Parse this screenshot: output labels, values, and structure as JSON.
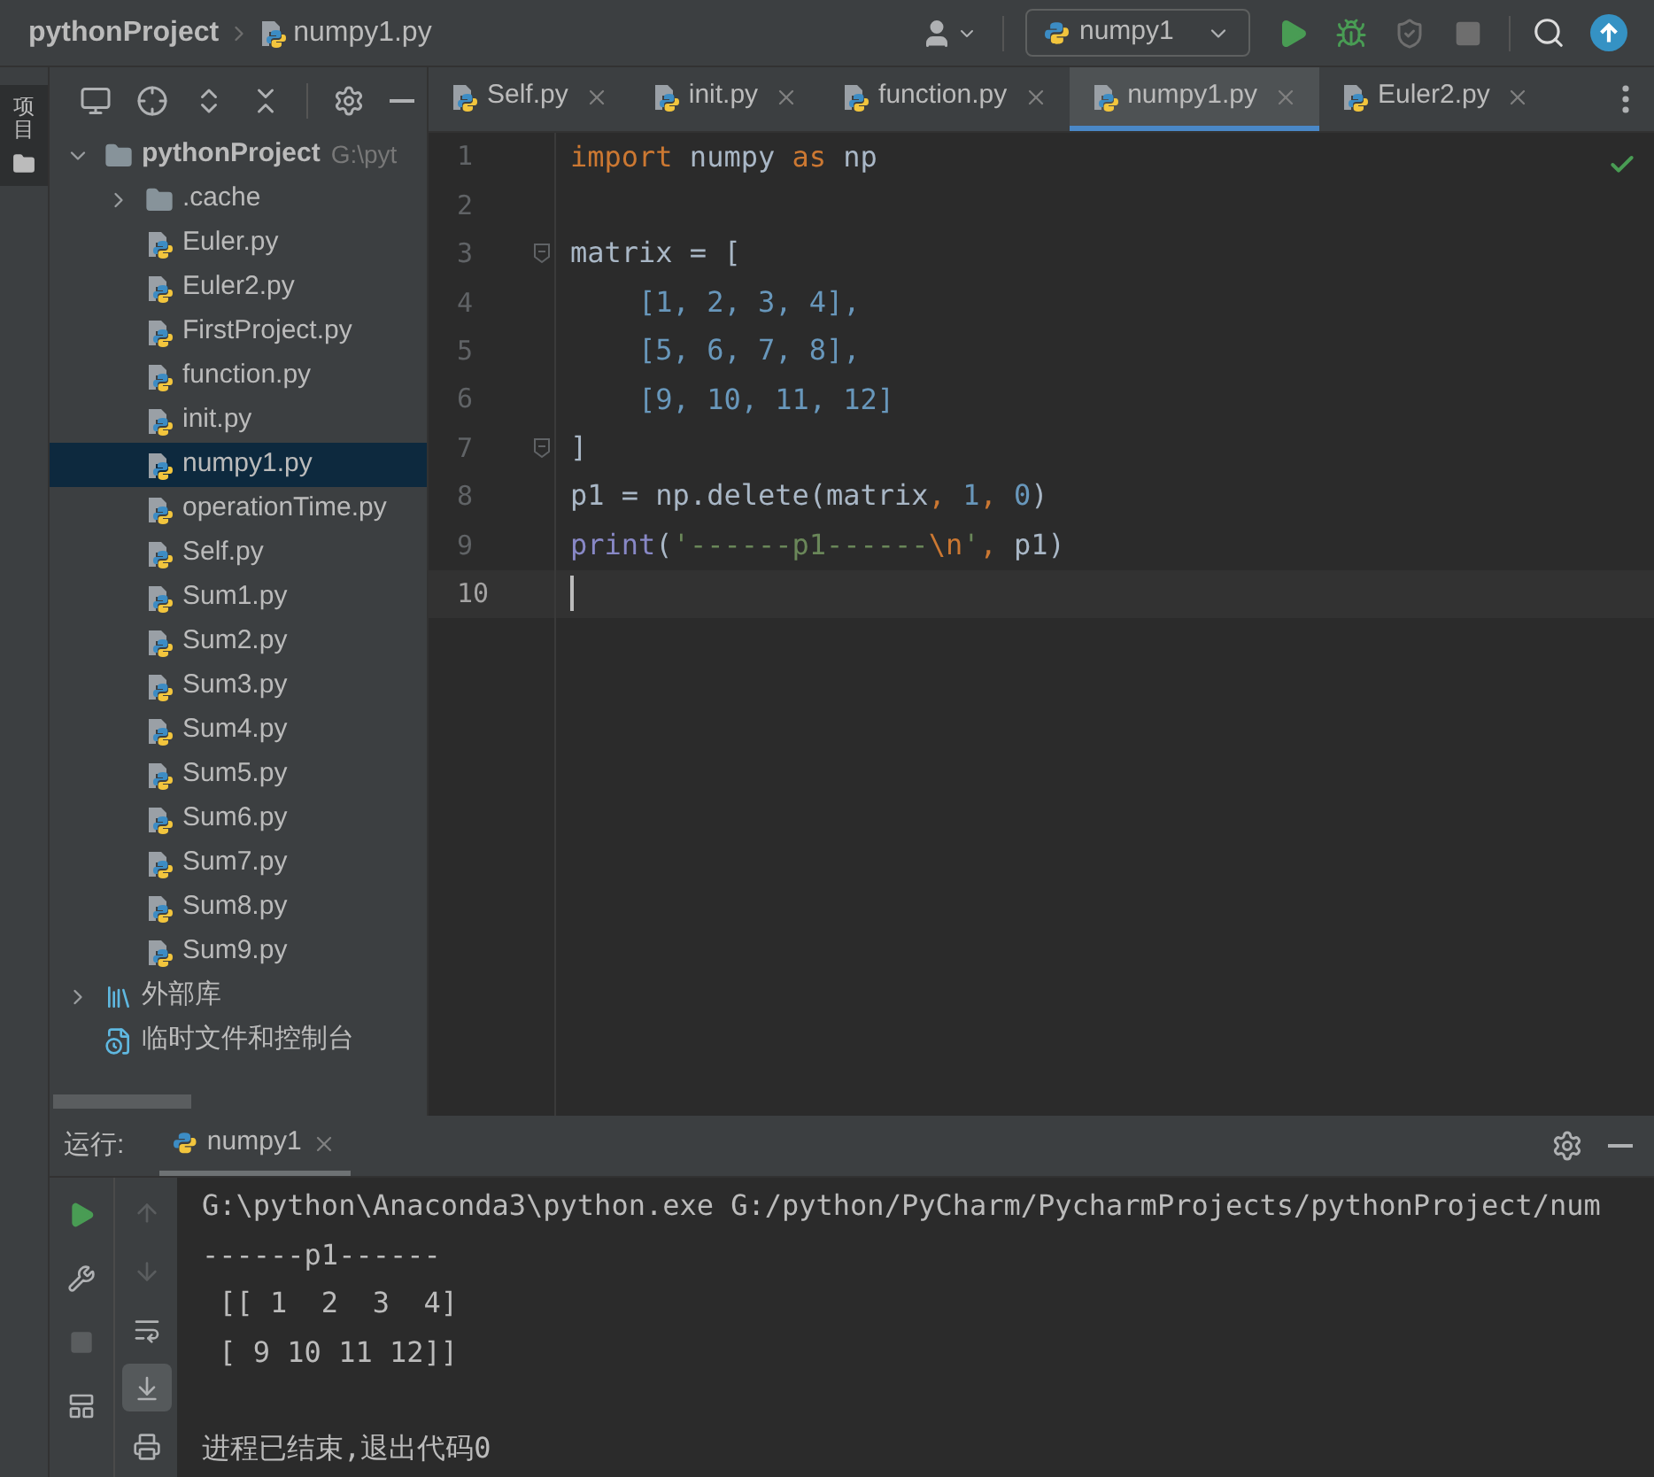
{
  "breadcrumb": [
    {
      "label": "pythonProject",
      "kind": "project"
    },
    {
      "label": "numpy1.py",
      "kind": "file"
    }
  ],
  "run_config": {
    "label": "numpy1"
  },
  "main_toolbar": [
    {
      "kind": "run",
      "disabled": false
    },
    {
      "kind": "debug",
      "disabled": false
    },
    {
      "kind": "coverage",
      "disabled": true
    },
    {
      "kind": "stop",
      "disabled": true
    }
  ],
  "tool_stripe": {
    "label": "项目",
    "selected": true
  },
  "editor_tabs": [
    {
      "label": "Self.py",
      "selected": false
    },
    {
      "label": "init.py",
      "selected": false
    },
    {
      "label": "function.py",
      "selected": false
    },
    {
      "label": "numpy1.py",
      "selected": true
    },
    {
      "label": "Euler2.py",
      "selected": false
    }
  ],
  "project_tree": [
    {
      "label": "pythonProject",
      "path": "G:\\pyt",
      "kind": "folder",
      "expanded": true,
      "selected": false,
      "children": [
        {
          "label": ".cache",
          "kind": "folder",
          "expanded": false,
          "selected": false
        },
        {
          "label": "Euler.py",
          "kind": "file",
          "selected": false
        },
        {
          "label": "Euler2.py",
          "kind": "file",
          "selected": false
        },
        {
          "label": "FirstProject.py",
          "kind": "file",
          "selected": false
        },
        {
          "label": "function.py",
          "kind": "file",
          "selected": false
        },
        {
          "label": "init.py",
          "kind": "file",
          "selected": false
        },
        {
          "label": "numpy1.py",
          "kind": "file",
          "selected": true
        },
        {
          "label": "operationTime.py",
          "kind": "file",
          "selected": false
        },
        {
          "label": "Self.py",
          "kind": "file",
          "selected": false
        },
        {
          "label": "Sum1.py",
          "kind": "file",
          "selected": false
        },
        {
          "label": "Sum2.py",
          "kind": "file",
          "selected": false
        },
        {
          "label": "Sum3.py",
          "kind": "file",
          "selected": false
        },
        {
          "label": "Sum4.py",
          "kind": "file",
          "selected": false
        },
        {
          "label": "Sum5.py",
          "kind": "file",
          "selected": false
        },
        {
          "label": "Sum6.py",
          "kind": "file",
          "selected": false
        },
        {
          "label": "Sum7.py",
          "kind": "file",
          "selected": false
        },
        {
          "label": "Sum8.py",
          "kind": "file",
          "selected": false
        },
        {
          "label": "Sum9.py",
          "kind": "file",
          "selected": false
        }
      ]
    },
    {
      "label": "外部库",
      "kind": "library",
      "expanded": false,
      "selected": false
    },
    {
      "label": "临时文件和控制台",
      "kind": "scratch",
      "selected": false
    }
  ],
  "editor": {
    "lines": [
      {
        "number": "1",
        "current": false,
        "fold": false,
        "tokens": [
          {
            "t": "import",
            "kind": "keyword"
          },
          {
            "t": " numpy ",
            "kind": "plain"
          },
          {
            "t": "as",
            "kind": "keyword"
          },
          {
            "t": " np",
            "kind": "plain"
          }
        ]
      },
      {
        "number": "2",
        "current": false,
        "fold": false
      },
      {
        "number": "3",
        "current": false,
        "fold": true,
        "tokens": [
          {
            "t": "matrix = [",
            "kind": "plain"
          }
        ]
      },
      {
        "number": "4",
        "current": false,
        "fold": false,
        "tokens": [
          {
            "t": "    [1, 2, 3, 4],",
            "kind": "number"
          }
        ]
      },
      {
        "number": "5",
        "current": false,
        "fold": false,
        "tokens": [
          {
            "t": "    [5, 6, 7, 8],",
            "kind": "number"
          }
        ]
      },
      {
        "number": "6",
        "current": false,
        "fold": false,
        "tokens": [
          {
            "t": "    [9, 10, 11, 12]",
            "kind": "number"
          }
        ]
      },
      {
        "number": "7",
        "current": false,
        "fold": true,
        "tokens": [
          {
            "t": "]",
            "kind": "plain"
          }
        ]
      },
      {
        "number": "8",
        "current": false,
        "fold": false,
        "tokens": [
          {
            "t": "p1 = np.delete(matrix",
            "kind": "plain"
          },
          {
            "t": ", ",
            "kind": "keyword"
          },
          {
            "t": "1",
            "kind": "number"
          },
          {
            "t": ", ",
            "kind": "keyword"
          },
          {
            "t": "0",
            "kind": "number"
          },
          {
            "t": ")",
            "kind": "plain"
          }
        ]
      },
      {
        "number": "9",
        "current": false,
        "fold": false,
        "tokens": [
          {
            "t": "print",
            "kind": "builtin"
          },
          {
            "t": "(",
            "kind": "plain"
          },
          {
            "t": "'------p1------",
            "kind": "string"
          },
          {
            "t": "\\n",
            "kind": "keyword"
          },
          {
            "t": "'",
            "kind": "string"
          },
          {
            "t": ", ",
            "kind": "keyword"
          },
          {
            "t": "p1)",
            "kind": "plain"
          }
        ]
      },
      {
        "number": "10",
        "current": true,
        "fold": false
      }
    ]
  },
  "run_panel": {
    "label": "运行:",
    "tab": {
      "label": "numpy1",
      "selected": true
    },
    "toolbar_left": [
      {
        "kind": "rerun",
        "disabled": false
      },
      {
        "kind": "settings",
        "disabled": false
      },
      {
        "kind": "stop",
        "disabled": true
      },
      {
        "kind": "layout",
        "disabled": false
      }
    ],
    "toolbar_right": [
      {
        "kind": "up",
        "disabled": true,
        "selected": false
      },
      {
        "kind": "down",
        "disabled": true,
        "selected": false
      },
      {
        "kind": "wrap",
        "disabled": false,
        "selected": false
      },
      {
        "kind": "scroll_end",
        "disabled": false,
        "selected": true
      },
      {
        "kind": "print",
        "disabled": false,
        "selected": false
      }
    ],
    "output": [
      {
        "text": "G:\\python\\Anaconda3\\python.exe G:/python/PyCharm/PycharmProjects/pythonProject/num",
        "kind": "command"
      },
      {
        "text": "------p1------",
        "kind": "stdout"
      },
      {
        "text": " [[ 1  2  3  4]",
        "kind": "stdout"
      },
      {
        "text": " [ 9 10 11 12]]",
        "kind": "stdout"
      },
      {
        "text": "进程已结束,退出代码0",
        "kind": "exit"
      }
    ]
  }
}
